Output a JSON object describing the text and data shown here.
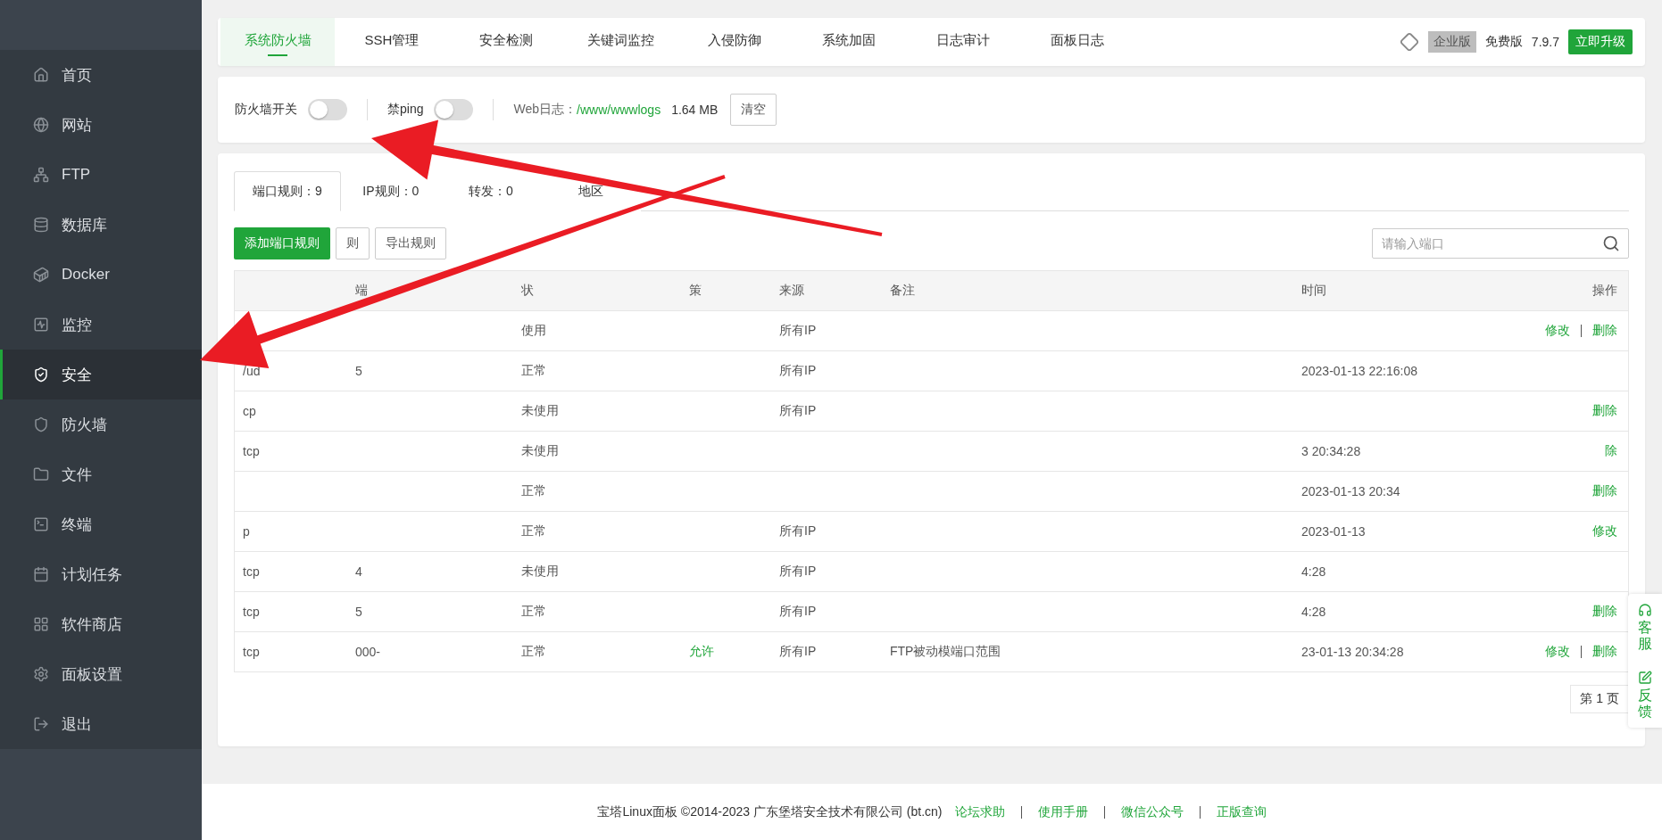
{
  "sidebar": {
    "items": [
      {
        "label": "首页",
        "selected": false
      },
      {
        "label": "网站",
        "selected": false
      },
      {
        "label": "FTP",
        "selected": false
      },
      {
        "label": "数据库",
        "selected": false
      },
      {
        "label": "Docker",
        "selected": false
      },
      {
        "label": "监控",
        "selected": false
      },
      {
        "label": "安全",
        "selected": true
      },
      {
        "label": "防火墙",
        "selected": false
      },
      {
        "label": "文件",
        "selected": false
      },
      {
        "label": "终端",
        "selected": false
      },
      {
        "label": "计划任务",
        "selected": false
      },
      {
        "label": "软件商店",
        "selected": false
      },
      {
        "label": "面板设置",
        "selected": false
      },
      {
        "label": "退出",
        "selected": false
      }
    ]
  },
  "top_nav": {
    "tabs": [
      {
        "label": "系统防火墙",
        "selected": true
      },
      {
        "label": "SSH管理",
        "selected": false
      },
      {
        "label": "安全检测",
        "selected": false
      },
      {
        "label": "关键词监控",
        "selected": false
      },
      {
        "label": "入侵防御",
        "selected": false
      },
      {
        "label": "系统加固",
        "selected": false
      },
      {
        "label": "日志审计",
        "selected": false
      },
      {
        "label": "面板日志",
        "selected": false
      }
    ],
    "edition_badge": "企业版",
    "free_label": "免费版",
    "version": "7.9.7",
    "upgrade_button": "立即升级"
  },
  "firewall_bar": {
    "switches": [
      {
        "label": "防火墙开关",
        "on": false
      },
      {
        "label": "禁ping",
        "on": false
      }
    ],
    "log_label": "Web日志：",
    "log_path": "/www/wwwlogs",
    "log_size": "1.64 MB",
    "clear_button": "清空"
  },
  "rules": {
    "tabs": [
      {
        "label": "端口规则：9",
        "selected": true
      },
      {
        "label": "IP规则：0",
        "selected": false
      },
      {
        "label": "转发：0",
        "selected": false
      },
      {
        "label": "地区",
        "selected": false
      }
    ],
    "buttons": [
      {
        "label": "添加端口规则",
        "kind": "primary"
      },
      {
        "label": "则",
        "kind": "plain"
      },
      {
        "label": "导出规则",
        "kind": "plain"
      }
    ],
    "search": {
      "placeholder": "请输入端口"
    },
    "columns": [
      "",
      "端",
      "状",
      "策",
      "来源",
      "备注",
      "时间",
      "操作"
    ],
    "rows": [
      {
        "cells": [
          "",
          "",
          "使用",
          "",
          "所有IP",
          "",
          ""
        ],
        "actions": [
          "修改",
          "删除"
        ]
      },
      {
        "cells": [
          "/ud",
          "5",
          "正常",
          "",
          "所有IP",
          "",
          "2023-01-13 22:16:08"
        ],
        "actions": []
      },
      {
        "cells": [
          "cp",
          "",
          "未使用",
          "",
          "所有IP",
          "",
          ""
        ],
        "actions": [
          "删除"
        ]
      },
      {
        "cells": [
          "tcp",
          "",
          "未使用",
          "",
          "",
          "",
          "3 20:34:28"
        ],
        "actions": [
          "除"
        ]
      },
      {
        "cells": [
          "",
          "",
          "正常",
          "",
          "",
          "",
          "2023-01-13 20:34"
        ],
        "actions": [
          "删除"
        ]
      },
      {
        "cells": [
          "p",
          "",
          "正常",
          "",
          "所有IP",
          "",
          "2023-01-13"
        ],
        "actions": [
          "修改"
        ]
      },
      {
        "cells": [
          "tcp",
          "4",
          "未使用",
          "",
          "所有IP",
          "",
          "4:28"
        ],
        "actions": []
      },
      {
        "cells": [
          "tcp",
          "5",
          "正常",
          "",
          "所有IP",
          "",
          "4:28"
        ],
        "actions": [
          "删除"
        ]
      },
      {
        "cells": [
          "tcp",
          "000-",
          "正常",
          "允许",
          "所有IP",
          "FTP被动模端口范围",
          "23-01-13 20:34:28"
        ],
        "actions": [
          "修改",
          "删除"
        ]
      }
    ],
    "pagination": "第 1 页"
  },
  "side_float": [
    {
      "label": "客服"
    },
    {
      "label": "反馈"
    }
  ],
  "footer": {
    "copyright": "宝塔Linux面板 ©2014-2023 广东堡塔安全技术有限公司 (bt.cn)",
    "links": [
      "论坛求助",
      "使用手册",
      "微信公众号",
      "正版查询"
    ]
  }
}
